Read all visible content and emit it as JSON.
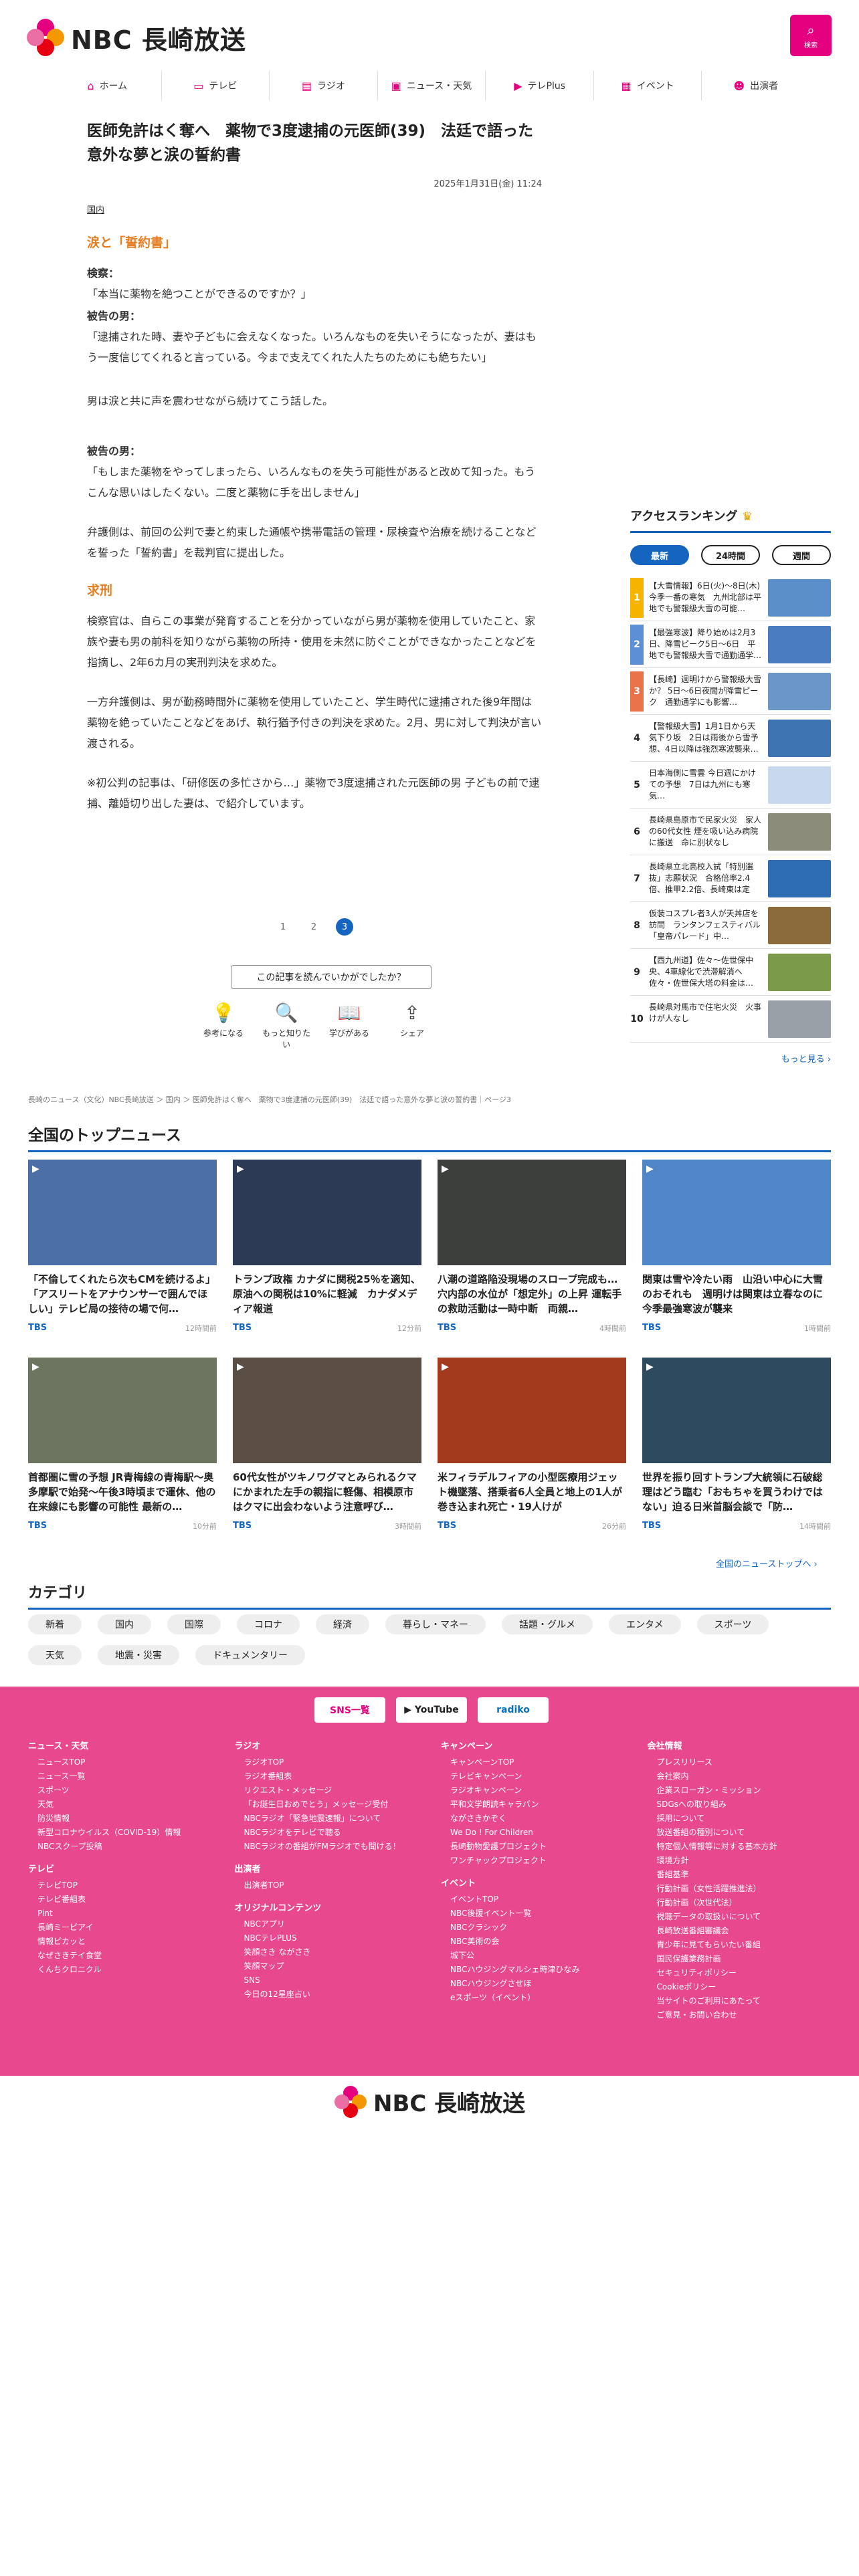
{
  "site": {
    "logo_text": "NBC 長崎放送",
    "search_label": "検索"
  },
  "nav": [
    {
      "icon": "⌂",
      "label": "ホーム"
    },
    {
      "icon": "▭",
      "label": "テレビ"
    },
    {
      "icon": "▤",
      "label": "ラジオ"
    },
    {
      "icon": "▣",
      "label": "ニュース・天気"
    },
    {
      "icon": "▶",
      "label": "テレPlus"
    },
    {
      "icon": "▦",
      "label": "イベント"
    },
    {
      "icon": "☻",
      "label": "出演者"
    }
  ],
  "article": {
    "title": "医師免許はく奪へ　薬物で3度逮捕の元医師(39)　法廷で語った意外な夢と涙の誓約書",
    "date": "2025年1月31日(金) 11:24",
    "category": "国内",
    "h1": "涙と「誓約書」",
    "p1_label": "検察：",
    "p1": "「本当に薬物を絶つことができるのですか？」",
    "p2_label": "被告の男：",
    "p2": "「逮捕された時、妻や子どもに会えなくなった。いろんなものを失いそうになったが、妻はもう一度信じてくれると言っている。今まで支えてくれた人たちのためにも絶ちたい」",
    "p3": "男は涙と共に声を震わせながら続けてこう話した。",
    "p4_label": "被告の男：",
    "p4": "「もしまた薬物をやってしまったら、いろんなものを失う可能性があると改めて知った。もうこんな思いはしたくない。二度と薬物に手を出しません」",
    "p5": "弁護側は、前回の公判で妻と約束した通帳や携帯電話の管理・尿検査や治療を続けることなどを誓った「誓約書」を裁判官に提出した。",
    "h2": "求刑",
    "p6": "検察官は、自らこの事業が発育することを分かっていながら男が薬物を使用していたこと、家族や妻も男の前科を知りながら薬物の所持・使用を未然に防ぐことができなかったことなどを指摘し、2年6カ月の実刑判決を求めた。",
    "p7": "一方弁護側は、男が勤務時間外に薬物を使用していたこと、学生時代に逮捕された後9年間は薬物を絶っていたことなどをあげ、執行猶予付きの判決を求めた。2月、男に対して判決が言い渡される。",
    "p8": "※初公判の記事は、「研修医の多忙さから…」薬物で3度逮捕された元医師の男 子どもの前で逮捕、離婚切り出した妻は、で紹介しています。"
  },
  "pager": [
    "1",
    "2",
    "3"
  ],
  "survey": {
    "question": "この記事を読んでいかがでしたか？"
  },
  "reactions": [
    {
      "icon": "💡",
      "label": "参考になる"
    },
    {
      "icon": "🔍",
      "label": "もっと知りたい"
    },
    {
      "icon": "📖",
      "label": "学びがある"
    },
    {
      "icon": "⇪",
      "label": "シェア"
    }
  ],
  "ranking": {
    "title": "アクセスランキング",
    "tabs": [
      "最新",
      "24時間",
      "週間"
    ],
    "items": [
      {
        "no": "1",
        "text": "【大雪情報】6日(火)〜8日(木)今季一番の寒気　九州北部は平地でも警報級大雪の可能…",
        "color": "#5b8fc9"
      },
      {
        "no": "2",
        "text": "【最強寒波】降り始めは2月3日、降雪ピーク5日〜6日　平地でも警報級大雪で通勤通学…",
        "color": "#4a7dbf"
      },
      {
        "no": "3",
        "text": "【長崎】週明けから警報級大雪か？ 5日〜6日夜間が降雪ピーク　通勤通学にも影響…",
        "color": "#6a96c8"
      },
      {
        "no": "4",
        "text": "【警報級大雪】1月1日から天気下り坂　2日は雨後から雪予想、4日以降は強烈寒波襲来…",
        "color": "#3f74b3"
      },
      {
        "no": "5",
        "text": "日本海側に雪雲 今日週にかけての予想　7日は九州にも寒気…",
        "color": "#c8d8ee"
      },
      {
        "no": "6",
        "text": "長崎県島原市で民家火災　家人の60代女性 煙を吸い込み病院に搬送　命に別状なし",
        "color": "#8c8c7a"
      },
      {
        "no": "7",
        "text": "長崎県立北高校入試「特別選抜」志願状況　合格倍率2.4倍、推甲2.2倍、長崎東は定員…",
        "color": "#2e6db4"
      },
      {
        "no": "8",
        "text": "仮装コスプレ者3人が天丼店を訪問　ランタンフェスティバル「皇帝パレード」中…",
        "color": "#8a6a3a"
      },
      {
        "no": "9",
        "text": "【西九州道】佐々〜佐世保中央、4車線化で渋滞解消へ　佐々・佐世保大塔の料金は…",
        "color": "#7a9a4a"
      },
      {
        "no": "10",
        "text": "長崎県対馬市で住宅火災　火事　けが人なし",
        "color": "#9aa0a8"
      }
    ],
    "more": "もっと見る ›"
  },
  "breadcrumb": "長崎のニュース（文化）NBC長崎放送 ＞ 国内 ＞ 医師免許はく奪へ　薬物で3度逮捕の元医師(39)　法廷で語った意外な夢と涙の誓約書｜ページ3",
  "top_news": {
    "title": "全国のトップニュース",
    "items": [
      {
        "title": "「不倫してくれたら次もCMを続けるよ」「アスリートをアナウンサーで囲んでほしい」テレビ局の接待の場で何…",
        "src": "TBS",
        "ago": "12時間前",
        "bg": "#4d6fa8"
      },
      {
        "title": "トランプ政権 カナダに関税25％を適知、原油への関税は10%に軽減　カナダメディア報道",
        "src": "TBS",
        "ago": "12分前",
        "bg": "#2c3a55"
      },
      {
        "title": "八潮の道路陥没現場のスロープ完成も…穴内部の水位が「想定外」の上昇 運転手の救助活動は一時中断　両親…",
        "src": "TBS",
        "ago": "4時間前",
        "bg": "#3d3f3c"
      },
      {
        "title": "関東は雪や冷たい雨　山沿い中心に大雪のおそれも　週明けは関東は立春なのに今季最強寒波が襲来",
        "src": "TBS",
        "ago": "1時間前",
        "bg": "#4f86c7"
      },
      {
        "title": "首都圏に雪の予想 JR青梅線の青梅駅〜奥多摩駅で始発〜午後3時頃まで運休、他の在来線にも影響の可能性 最新の…",
        "src": "TBS",
        "ago": "10分前",
        "bg": "#6b7560"
      },
      {
        "title": "60代女性がツキノワグマとみられるクマにかまれた左手の親指に軽傷、相模原市はクマに出会わないよう注意呼び…",
        "src": "TBS",
        "ago": "3時間前",
        "bg": "#5a4d44"
      },
      {
        "title": "米フィラデルフィアの小型医療用ジェット機墜落、搭乗者6人全員と地上の1人が巻き込まれ死亡・19人けが",
        "src": "TBS",
        "ago": "26分前",
        "bg": "#a33a1e"
      },
      {
        "title": "世界を振り回すトランプ大統領に石破総理はどう臨む「おもちゃを買うわけではない」迫る日米首脳会談で「防…",
        "src": "TBS",
        "ago": "14時間前",
        "bg": "#2d4a5e"
      }
    ],
    "more": "全国のニューストップへ ›"
  },
  "categories": {
    "title": "カテゴリ",
    "items": [
      "新着",
      "国内",
      "国際",
      "コロナ",
      "経済",
      "暮らし・マネー",
      "話題・グルメ",
      "エンタメ",
      "スポーツ",
      "天気",
      "地震・災害",
      "ドキュメンタリー"
    ]
  },
  "footer": {
    "sns": [
      "SNS一覧",
      "▶ YouTube",
      "radiko"
    ],
    "cols": [
      [
        {
          "h": "ニュース・天気",
          "items": [
            "ニュースTOP",
            "ニュース一覧",
            "スポーツ",
            "天気",
            "防災情報",
            "新型コロナウイルス（COVID-19）情報",
            "NBCスクープ投稿"
          ]
        },
        {
          "h": "テレビ",
          "items": [
            "テレビTOP",
            "テレビ番組表",
            "Pint",
            "長崎ミーピアイ",
            "情報ピカッと",
            "なぜさきテイ食堂",
            "くんちクロニクル"
          ]
        }
      ],
      [
        {
          "h": "ラジオ",
          "items": [
            "ラジオTOP",
            "ラジオ番組表",
            "リクエスト・メッセージ",
            "「お誕生日おめでとう」メッセージ受付",
            "NBCラジオ「緊急地震速報」について",
            "NBCラジオをテレビで聴る",
            "NBCラジオの番組がFMラジオでも聞ける！"
          ]
        },
        {
          "h": "出演者",
          "items": [
            "出演者TOP"
          ]
        },
        {
          "h": "オリジナルコンテンツ",
          "items": [
            "NBCアプリ",
            "NBCテレPLUS",
            "笑顔さき ながさき",
            "笑顔マップ",
            "SNS",
            "今日の12星座占い"
          ]
        }
      ],
      [
        {
          "h": "キャンペーン",
          "items": [
            "キャンペーンTOP",
            "テレビキャンペーン",
            "ラジオキャンペーン",
            "平和文学朗読キャラバン",
            "ながさきかぞく",
            "We Do ! For Children",
            "長崎動物愛護プロジェクト",
            "ワンチャックプロジェクト"
          ]
        },
        {
          "h": "イベント",
          "items": [
            "イベントTOP",
            "NBC後援イベント一覧",
            "NBCクラシック",
            "NBC美術の会",
            "城下公",
            "NBCハウジングマルシェ時津ひなみ",
            "NBCハウジングさせほ",
            "eスポーツ（イベント）"
          ]
        }
      ],
      [
        {
          "h": "会社情報",
          "items": [
            "プレスリリース",
            "会社案内",
            "企業スローガン・ミッション",
            "SDGsへの取り組み",
            "採用について",
            "放送番組の種別について",
            "特定個人情報等に対する基本方針",
            "環境方針",
            "番組基準",
            "行動計画（女性活躍推進法）",
            "行動計画（次世代法）",
            "視聴データの取扱いについて",
            "長崎放送番組審議会",
            "青少年に見てもらいたい番組",
            "国民保護業務計画",
            "セキュリティポリシー",
            "Cookieポリシー",
            "当サイトのご利用にあたって",
            "ご意見・お問い合わせ"
          ]
        }
      ]
    ]
  },
  "colors": {
    "brand": "#e4007f",
    "accent": "#1565c0",
    "heading_orange": "#e67e22",
    "footer_bg": "#e8488e"
  }
}
